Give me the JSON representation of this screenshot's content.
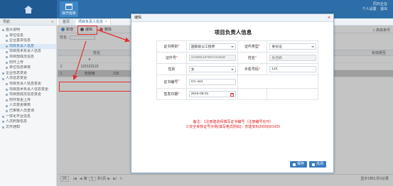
{
  "header": {
    "nav_label": "操作面板",
    "user_line": "同日企业",
    "links": [
      "个人设置",
      "退出"
    ]
  },
  "sidebar": {
    "title": "导航",
    "items": [
      {
        "label": "首页说明",
        "level": 0
      },
      {
        "label": "单位信息",
        "level": 1
      },
      {
        "label": "企业基本信息",
        "level": 1
      },
      {
        "label": "项目负责人信息",
        "level": 1
      },
      {
        "label": "项目技术负责人信息",
        "level": 1
      },
      {
        "label": "项目部成员信息",
        "level": 1
      },
      {
        "label": "附件上传",
        "level": 1
      },
      {
        "label": "单位信息审核",
        "level": 1
      },
      {
        "label": "企业信息变更",
        "level": 0
      },
      {
        "label": "人员信息变更",
        "level": 0
      },
      {
        "label": "项目负责人信息变更",
        "level": 1
      },
      {
        "label": "项目技术负责人信息变更",
        "level": 1
      },
      {
        "label": "项目部成员信息变更",
        "level": 1
      },
      {
        "label": "附件变更上传",
        "level": 1
      },
      {
        "label": "人员变更审核",
        "level": 1
      },
      {
        "label": "已审核人员查询",
        "level": 1
      },
      {
        "label": "一体化平台信息",
        "level": 0
      },
      {
        "label": "人员照报信息",
        "level": 0
      },
      {
        "label": "文件通知",
        "level": 0
      }
    ]
  },
  "tabs": [
    {
      "label": "首页"
    },
    {
      "label": "项目负责人信息"
    }
  ],
  "toolbar": {
    "add_label": "新增",
    "edit_label": "编辑",
    "delete_label": "删除",
    "advanced_search": "高级条件"
  },
  "search": {
    "name_label": "姓名:"
  },
  "grid": {
    "columns": {
      "name": "姓名",
      "valid_period": "有效期至"
    },
    "rows": [
      {
        "num": "",
        "name": "e",
        "extra": ""
      },
      {
        "num": "2",
        "name": "123123123",
        "extra": ""
      },
      {
        "num": "3",
        "name": "张佳楠",
        "extra": "210"
      }
    ]
  },
  "pager": {
    "page_size": "20",
    "page_prefix": "第",
    "page_num": "1",
    "page_suffix": "共1页",
    "summary": "显示1到3,共3记录"
  },
  "dialog": {
    "window_title": "编辑",
    "heading": "项目负责人信息",
    "fields": {
      "cert_category_label": "证书类别",
      "cert_category_value": "国家级以工程师",
      "id_type_label": "证件类型",
      "id_type_value": "身份证",
      "id_number_label": "证件号",
      "id_number_value": "210905197807210549",
      "name_label": "姓名",
      "name_value": "张佳楠",
      "gender_label": "性别",
      "gender_value": "女",
      "phone_label": "手机号码",
      "phone_value": "123",
      "cert_number_label": "证书编号",
      "cert_number_value": "CC-444",
      "issue_date_label": "签发日期",
      "issue_date_value": "2016-08-01"
    },
    "notes": [
      "备注：1注册建造师填写证书编号（注册编号也可）",
      "2.安全考核证号示例(填写格式例如)：苏建安B(2009)001425"
    ],
    "save_label": "保存",
    "close_label": "关闭"
  },
  "colors": {
    "header": "#2d6ea8",
    "accent": "#3a7cc0",
    "annotation": "#e03030"
  }
}
